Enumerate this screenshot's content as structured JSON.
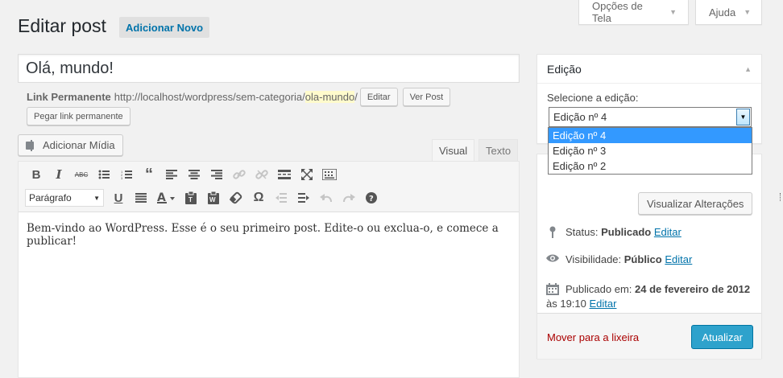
{
  "screen_tabs": {
    "options": "Opções de Tela",
    "help": "Ajuda"
  },
  "header": {
    "title": "Editar post",
    "add_new": "Adicionar Novo"
  },
  "post": {
    "title": "Olá, mundo!",
    "permalink_label": "Link Permanente",
    "permalink_base": "http://localhost/wordpress/sem-categoria/",
    "permalink_slug": "ola-mundo",
    "permalink_end": "/",
    "edit_btn": "Editar",
    "view_btn": "Ver Post",
    "shortlink_btn": "Pegar link permanente"
  },
  "editor": {
    "add_media": "Adicionar Mídia",
    "tab_visual": "Visual",
    "tab_text": "Texto",
    "format_select": "Parágrafo",
    "content": "Bem-vindo ao WordPress. Esse é o seu primeiro post. Edite-o ou exclua-o, e comece a publicar!",
    "toolbar_row1": [
      "bold",
      "italic",
      "strikethrough",
      "bullet-list",
      "numbered-list",
      "blockquote",
      "align-left",
      "align-center",
      "align-right",
      "insert-link",
      "remove-link",
      "read-more",
      "fullscreen",
      "toolbar-toggle"
    ],
    "toolbar_row2": [
      "underline",
      "justify",
      "text-color",
      "paste-text",
      "paste-word",
      "clear-formatting",
      "special-character",
      "outdent",
      "indent",
      "undo",
      "redo",
      "help"
    ]
  },
  "revisions_box": {
    "title": "Edição",
    "label": "Selecione a edição:",
    "selected": "Edição nº 4",
    "options": [
      "Edição nº 4",
      "Edição nº 3",
      "Edição nº 2"
    ]
  },
  "publish_box": {
    "preview": "Visualizar Alterações",
    "status_label": "Status:",
    "status_value": "Publicado",
    "visibility_label": "Visibilidade:",
    "visibility_value": "Público",
    "published_label": "Publicado em:",
    "published_value": "24 de fevereiro de 2012",
    "published_time": "às 19:10",
    "edit_link": "Editar",
    "trash": "Mover para a lixeira",
    "update": "Atualizar"
  },
  "colors": {
    "accent": "#0073aa",
    "primary_button": "#2ea2cc",
    "trash": "#aa0000",
    "selected_option": "#3399ff"
  }
}
